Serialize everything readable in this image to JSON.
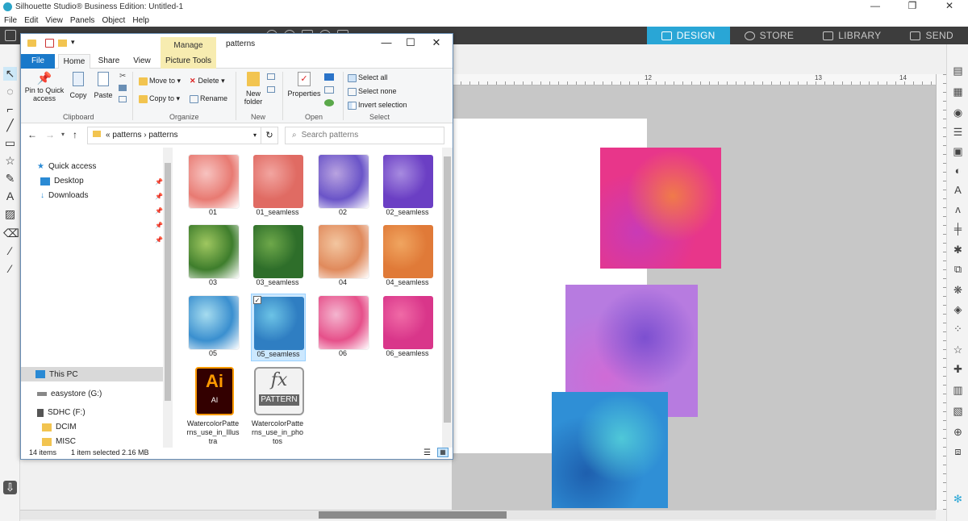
{
  "app": {
    "title": "Silhouette Studio® Business Edition: Untitled-1",
    "menus": [
      "File",
      "Edit",
      "View",
      "Panels",
      "Object",
      "Help"
    ],
    "tabs": [
      {
        "label": "DESIGN",
        "icon": "grid-icon",
        "active": true
      },
      {
        "label": "STORE",
        "icon": "globe-icon",
        "active": false
      },
      {
        "label": "LIBRARY",
        "icon": "download-icon",
        "active": false
      },
      {
        "label": "SEND",
        "icon": "printer-icon",
        "active": false
      }
    ],
    "ruler_numbers": [
      "12",
      "13",
      "14"
    ],
    "accent_color": "#29a6d6"
  },
  "explorer": {
    "title": "patterns",
    "manage_label": "Manage",
    "ribbon_tabs": [
      "File",
      "Home",
      "Share",
      "View",
      "Picture Tools"
    ],
    "ribbon": {
      "clipboard": {
        "pin": "Pin to Quick access",
        "copy": "Copy",
        "paste": "Paste",
        "label": "Clipboard"
      },
      "organize": {
        "move_to": "Move to",
        "copy_to": "Copy to",
        "delete": "Delete",
        "rename": "Rename",
        "label": "Organize"
      },
      "new": {
        "new_folder": "New folder",
        "label": "New"
      },
      "open": {
        "properties": "Properties",
        "label": "Open"
      },
      "select": {
        "select_all": "Select all",
        "select_none": "Select none",
        "invert": "Invert selection",
        "label": "Select"
      }
    },
    "address": {
      "crumbs": [
        "patterns",
        "patterns"
      ]
    },
    "search_placeholder": "Search patterns",
    "nav": {
      "quick_access": "Quick access",
      "desktop": "Desktop",
      "downloads": "Downloads",
      "this_pc": "This PC",
      "easystore": "easystore (G:)",
      "sdhc": "SDHC (F:)",
      "dcim": "DCIM",
      "misc": "MISC"
    },
    "files": [
      {
        "name": "01",
        "colors": [
          "#f7c3c0",
          "#e87a72"
        ]
      },
      {
        "name": "01_seamless",
        "colors": [
          "#f2a5a0",
          "#e06b63"
        ]
      },
      {
        "name": "02",
        "colors": [
          "#b9a3e0",
          "#6a54c8"
        ]
      },
      {
        "name": "02_seamless",
        "colors": [
          "#a78be0",
          "#6b3fc4"
        ]
      },
      {
        "name": "03",
        "colors": [
          "#9fc760",
          "#3e7d2c"
        ]
      },
      {
        "name": "03_seamless",
        "colors": [
          "#6ea84a",
          "#2e6e2a"
        ]
      },
      {
        "name": "04",
        "colors": [
          "#f3c6a0",
          "#e08a5c"
        ]
      },
      {
        "name": "04_seamless",
        "colors": [
          "#f0a560",
          "#e07a38"
        ]
      },
      {
        "name": "05",
        "colors": [
          "#a6dcef",
          "#3a8fcf"
        ]
      },
      {
        "name": "05_seamless",
        "colors": [
          "#6cc3e6",
          "#2f7ec2"
        ]
      },
      {
        "name": "06",
        "colors": [
          "#f4b5cf",
          "#e6508a"
        ]
      },
      {
        "name": "06_seamless",
        "colors": [
          "#f06aa6",
          "#d9368a"
        ]
      }
    ],
    "special_files": [
      {
        "name": "WatercolorPatterns_use_in_Illustra",
        "badge_top": "Ai",
        "badge_bottom": "AI"
      },
      {
        "name": "WatercolorPatterns_use_in_photos",
        "badge_top": "fx",
        "badge_bottom": "PATTERN"
      }
    ],
    "status": {
      "count": "14 items",
      "selection": "1 item selected  2.16 MB"
    }
  },
  "canvas": {
    "swatches": [
      {
        "name": "pink-watercolor",
        "colors": [
          "#e8368a",
          "#f07a4a",
          "#c93ab6"
        ]
      },
      {
        "name": "purple-watercolor",
        "colors": [
          "#b77be0",
          "#7c4fd0",
          "#cf6bd6"
        ]
      },
      {
        "name": "blue-watercolor",
        "colors": [
          "#2f8fd6",
          "#4fc8d8",
          "#1e5fae"
        ]
      }
    ]
  }
}
